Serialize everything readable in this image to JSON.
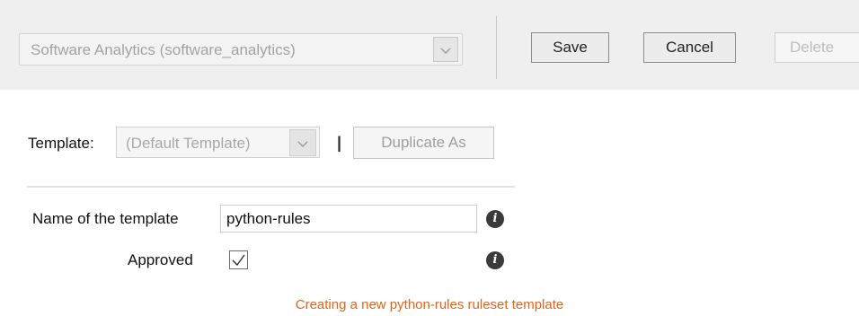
{
  "toolbar": {
    "project_select": "Software Analytics (software_analytics)",
    "save_label": "Save",
    "cancel_label": "Cancel",
    "delete_label": "Delete"
  },
  "template": {
    "label": "Template:",
    "selected": "(Default Template)",
    "separator": "|",
    "duplicate_label": "Duplicate As"
  },
  "form": {
    "name_label": "Name of the template",
    "name_value": "python-rules",
    "approved_label": "Approved",
    "approved_checked": true,
    "info_glyph": "i"
  },
  "caption": "Creating a new python-rules ruleset template",
  "colors": {
    "caption": "#e0641c",
    "toolbar_bg": "#efefef"
  }
}
